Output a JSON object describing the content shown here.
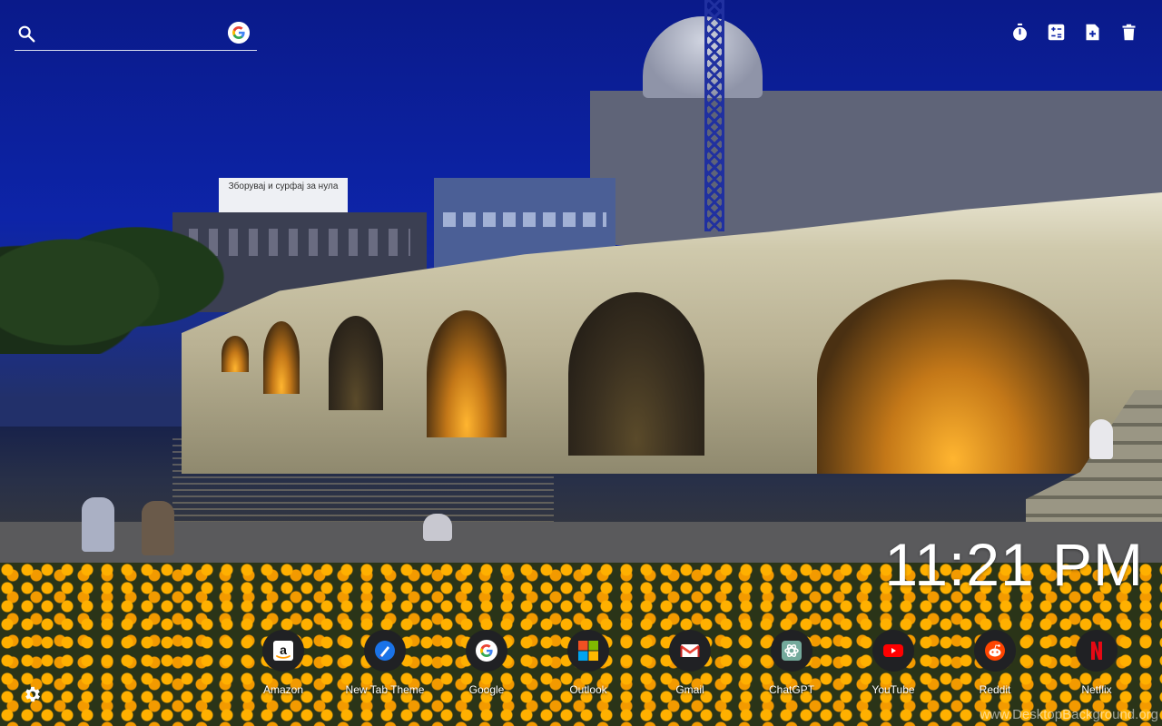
{
  "search": {
    "placeholder": "",
    "value": "",
    "engine_icon": "google-icon"
  },
  "toolbar": {
    "items": [
      {
        "icon": "timer-icon"
      },
      {
        "icon": "calculator-icon"
      },
      {
        "icon": "new-note-icon"
      },
      {
        "icon": "trash-icon"
      }
    ]
  },
  "clock": {
    "time": "11:21 PM"
  },
  "shortcuts": [
    {
      "label": "Amazon",
      "icon": "amazon-icon",
      "color": "#ffffff"
    },
    {
      "label": "New Tab Theme",
      "icon": "new-tab-theme-icon",
      "color": "#1a73e8"
    },
    {
      "label": "Google",
      "icon": "google-icon",
      "color": "#4285f4"
    },
    {
      "label": "Outlook",
      "icon": "microsoft-icon",
      "color": "#f25022"
    },
    {
      "label": "Gmail",
      "icon": "gmail-icon",
      "color": "#ea4335"
    },
    {
      "label": "ChatGPT",
      "icon": "chatgpt-icon",
      "color": "#74aa9c"
    },
    {
      "label": "YouTube",
      "icon": "youtube-icon",
      "color": "#ff0000"
    },
    {
      "label": "Reddit",
      "icon": "reddit-icon",
      "color": "#ff4500"
    },
    {
      "label": "Netflix",
      "icon": "netflix-icon",
      "color": "#e50914"
    }
  ],
  "settings": {
    "icon": "gear-icon"
  },
  "background": {
    "billboard_text": "Зборувај и сурфај за нула",
    "watermark": "www.DesktopBackground.org"
  }
}
